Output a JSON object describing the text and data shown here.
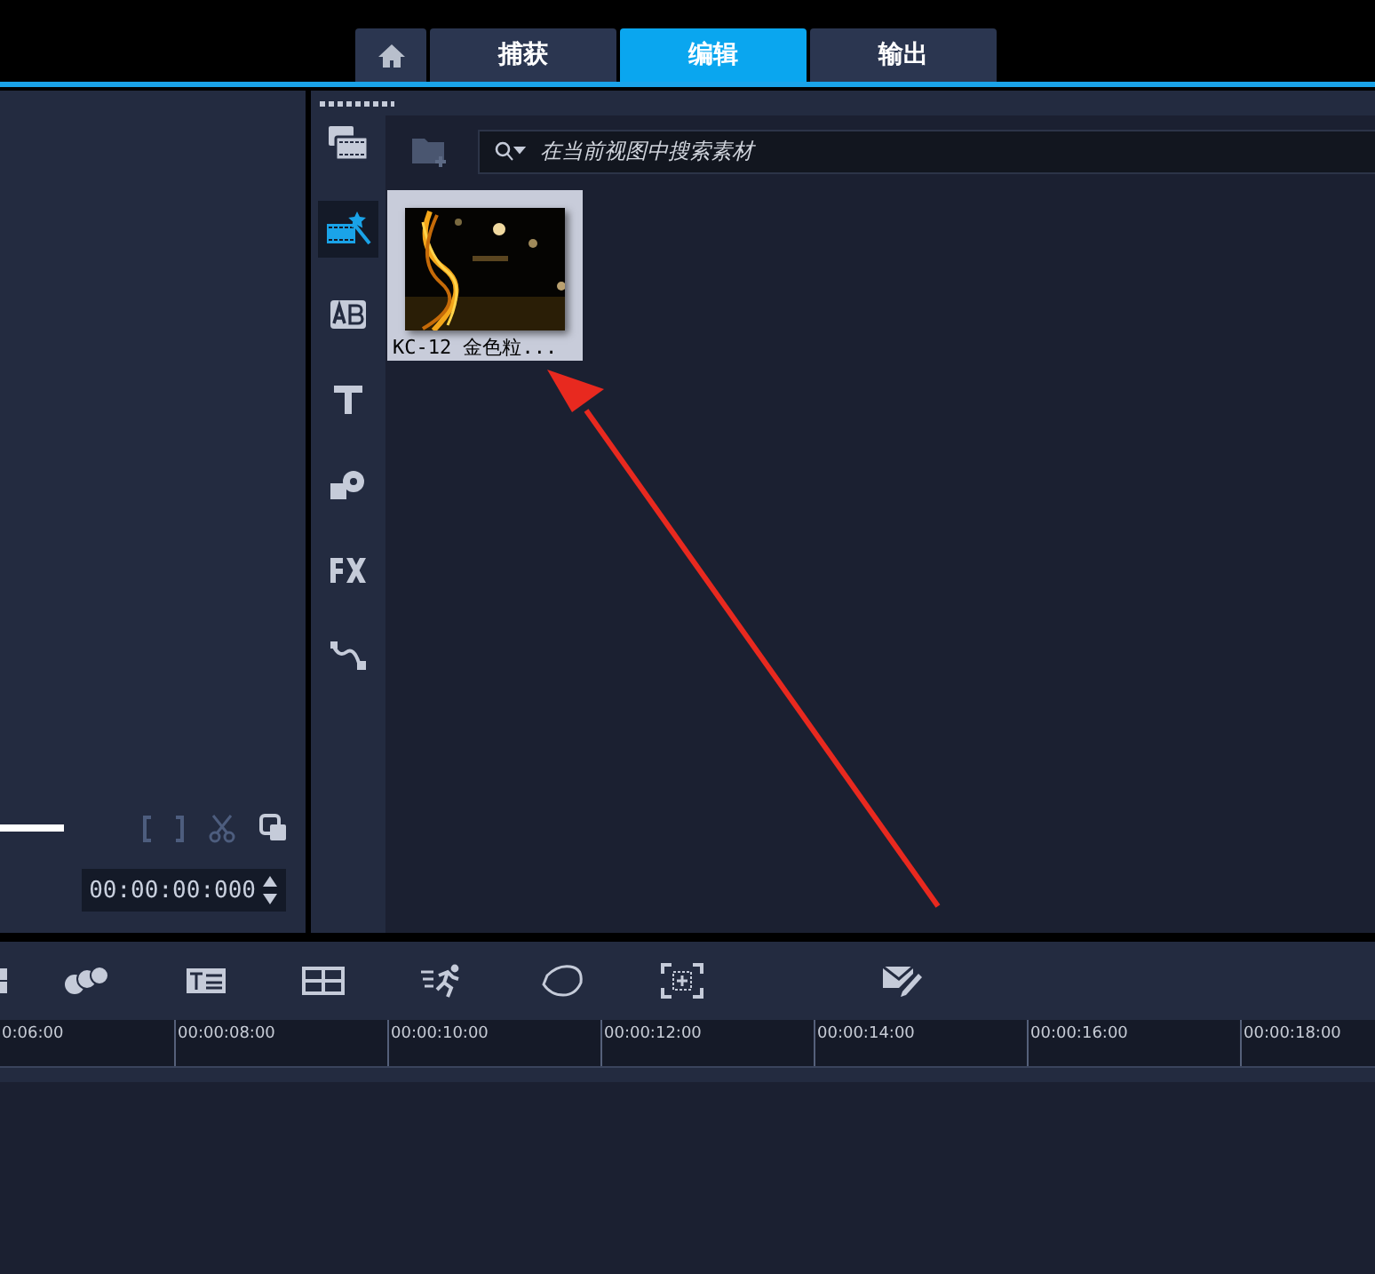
{
  "tabs": [
    {
      "kind": "home",
      "selected": false
    },
    {
      "kind": "text",
      "label": "捕获",
      "selected": false
    },
    {
      "kind": "text",
      "label": "编辑",
      "selected": true
    },
    {
      "kind": "text",
      "label": "输出",
      "selected": false
    }
  ],
  "preview": {
    "timecode": "00:00:00:000"
  },
  "library": {
    "search": {
      "placeholder": "在当前视图中搜索素材"
    },
    "sidebar": [
      {
        "kind": "media",
        "selected": false
      },
      {
        "kind": "instant",
        "selected": true
      },
      {
        "kind": "transition",
        "selected": false
      },
      {
        "kind": "title",
        "selected": false
      },
      {
        "kind": "graphic",
        "selected": false
      },
      {
        "kind": "filter",
        "selected": false
      },
      {
        "kind": "path",
        "selected": false
      }
    ],
    "clips": [
      {
        "label": "KC-12 金色粒...",
        "selected": true
      }
    ]
  },
  "toolbar": [
    {
      "kind": "grid"
    },
    {
      "kind": "blend"
    },
    {
      "kind": "title"
    },
    {
      "kind": "split"
    },
    {
      "kind": "motion"
    },
    {
      "kind": "mask"
    },
    {
      "kind": "track"
    },
    {
      "kind": "edit"
    }
  ],
  "ruler": [
    "0:06:00",
    "00:00:08:00",
    "00:00:10:00",
    "00:00:12:00",
    "00:00:14:00",
    "00:00:16:00",
    "00:00:18:00"
  ],
  "annotation": {
    "kind": "arrow"
  }
}
